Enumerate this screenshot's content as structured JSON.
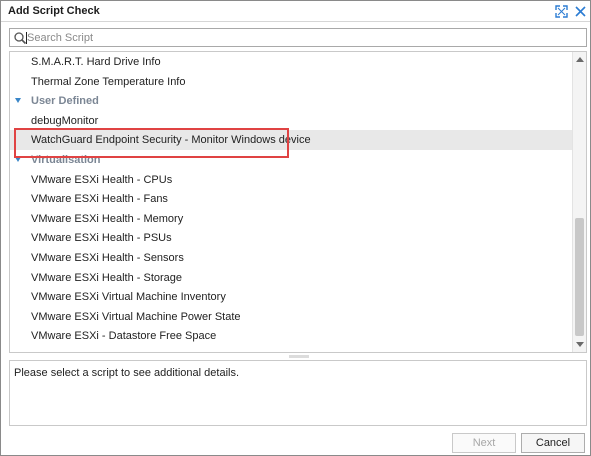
{
  "dialog": {
    "title": "Add Script Check"
  },
  "search": {
    "placeholder": "Search Script",
    "value": ""
  },
  "list": {
    "rows": [
      {
        "type": "item",
        "label": "S.M.A.R.T. Hard Drive Info"
      },
      {
        "type": "item",
        "label": "Thermal Zone Temperature Info"
      },
      {
        "type": "group",
        "label": "User Defined"
      },
      {
        "type": "item",
        "label": "debugMonitor"
      },
      {
        "type": "item",
        "label": "WatchGuard Endpoint Security - Monitor Windows device",
        "selected": true
      },
      {
        "type": "group",
        "label": "Virtualisation"
      },
      {
        "type": "item",
        "label": "VMware ESXi Health - CPUs"
      },
      {
        "type": "item",
        "label": "VMware ESXi Health - Fans"
      },
      {
        "type": "item",
        "label": "VMware ESXi Health - Memory"
      },
      {
        "type": "item",
        "label": "VMware ESXi Health - PSUs"
      },
      {
        "type": "item",
        "label": "VMware ESXi Health - Sensors"
      },
      {
        "type": "item",
        "label": "VMware ESXi Health - Storage"
      },
      {
        "type": "item",
        "label": "VMware ESXi Virtual Machine Inventory"
      },
      {
        "type": "item",
        "label": "VMware ESXi Virtual Machine Power State"
      },
      {
        "type": "item",
        "label": "VMware ESXi - Datastore Free Space"
      }
    ]
  },
  "details": {
    "text": "Please select a script to see additional details."
  },
  "buttons": {
    "next": "Next",
    "cancel": "Cancel"
  },
  "colors": {
    "highlight": "#e04343",
    "group_arrow": "#3a86c8",
    "title_icon": "#2b7cd3"
  },
  "icons": {
    "expand": "expand-icon",
    "close": "close-icon",
    "search": "search-icon",
    "group": "triangle-down-icon"
  }
}
